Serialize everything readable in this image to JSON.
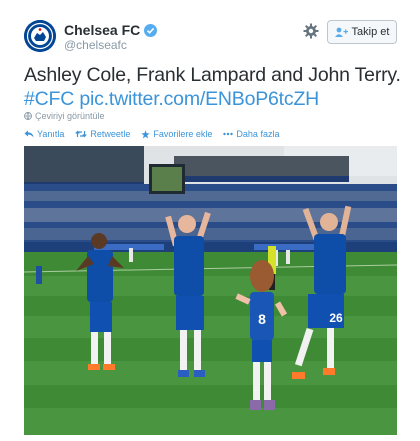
{
  "account": {
    "display_name": "Chelsea FC",
    "screen_name": "@chelseafc",
    "verified": true,
    "avatar_icon": "chelsea-crest-icon"
  },
  "header": {
    "settings_icon": "gear-icon",
    "follow_label": "Takip et"
  },
  "tweet": {
    "text_plain": "Ashley Cole, Frank Lampard and John Terry.",
    "hashtag": "#CFC",
    "link": "pic.twitter.com/ENBoP6tcZH",
    "translate_label": "Çeviriyi görüntüle"
  },
  "actions": [
    {
      "icon": "reply-icon",
      "label": "Yanıtla"
    },
    {
      "icon": "retweet-icon",
      "label": "Retweetle"
    },
    {
      "icon": "star-icon",
      "label": "Favorilere ekle"
    },
    {
      "icon": "more-icon",
      "label": "Daha fazla"
    }
  ],
  "photo": {
    "description_icon": "stadium-photo",
    "shirt_numbers": [
      "26",
      "8"
    ]
  },
  "colors": {
    "link": "#3b94d9",
    "text": "#292f33",
    "muted": "#8899a6",
    "chelsea_blue": "#034694",
    "pitch": "#3f8a34"
  }
}
